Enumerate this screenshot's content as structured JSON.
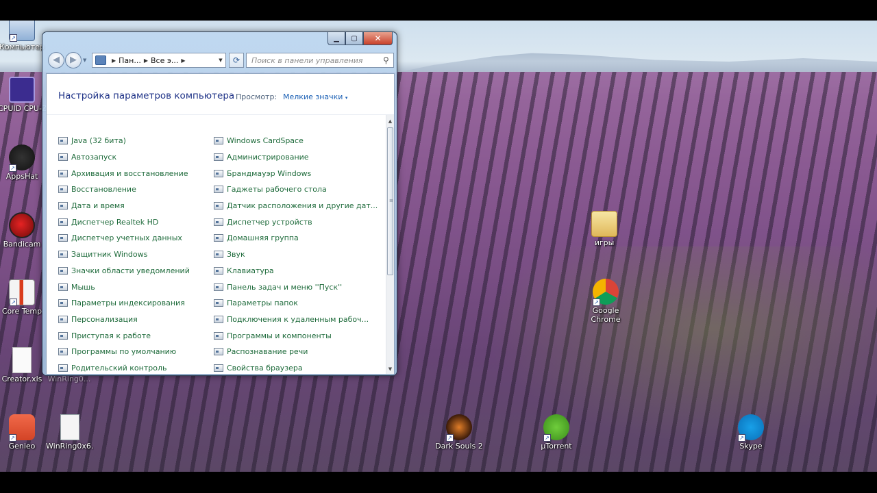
{
  "desktop": {
    "icons": [
      {
        "label": "Компьютер"
      },
      {
        "label": "CPUID CPU-Z"
      },
      {
        "label": "AppsHat"
      },
      {
        "label": "Bandicam"
      },
      {
        "label": "Core Temp"
      },
      {
        "label": "Creator.xls"
      },
      {
        "label": "WinRing0..."
      },
      {
        "label": "Genieo"
      },
      {
        "label": "WinRing0x6..."
      },
      {
        "label": "игры"
      },
      {
        "label": "Google Chrome"
      },
      {
        "label": "Dark Souls 2"
      },
      {
        "label": "µTorrent"
      },
      {
        "label": "Skype"
      }
    ]
  },
  "window": {
    "caption_buttons": {
      "minimize": "▁",
      "maximize": "▢",
      "close": "✕"
    },
    "nav": {
      "back": "◀",
      "forward": "▶",
      "breadcrumb": [
        "Пан...",
        "Все э..."
      ],
      "refresh": "⟳",
      "search_placeholder": "Поиск в панели управления",
      "search_icon": "⚲"
    },
    "header": {
      "title": "Настройка параметров компьютера",
      "view_label": "Просмотр:",
      "view_value": "Мелкие значки"
    },
    "items_col1": [
      "Java (32 бита)",
      "Автозапуск",
      "Архивация и восстановление",
      "Восстановление",
      "Дата и время",
      "Диспетчер Realtek HD",
      "Диспетчер учетных данных",
      "Защитник Windows",
      "Значки области уведомлений",
      "Мышь",
      "Параметры индексирования",
      "Персонализация",
      "Приступая к работе",
      "Программы по умолчанию",
      "Родительский контроль"
    ],
    "items_col2": [
      "Windows CardSpace",
      "Администрирование",
      "Брандмауэр Windows",
      "Гаджеты рабочего стола",
      "Датчик расположения и другие дат...",
      "Диспетчер устройств",
      "Домашняя группа",
      "Звук",
      "Клавиатура",
      "Панель задач и меню ''Пуск''",
      "Параметры папок",
      "Подключения к удаленным рабоч...",
      "Программы и компоненты",
      "Распознавание речи",
      "Свойства браузера"
    ]
  }
}
